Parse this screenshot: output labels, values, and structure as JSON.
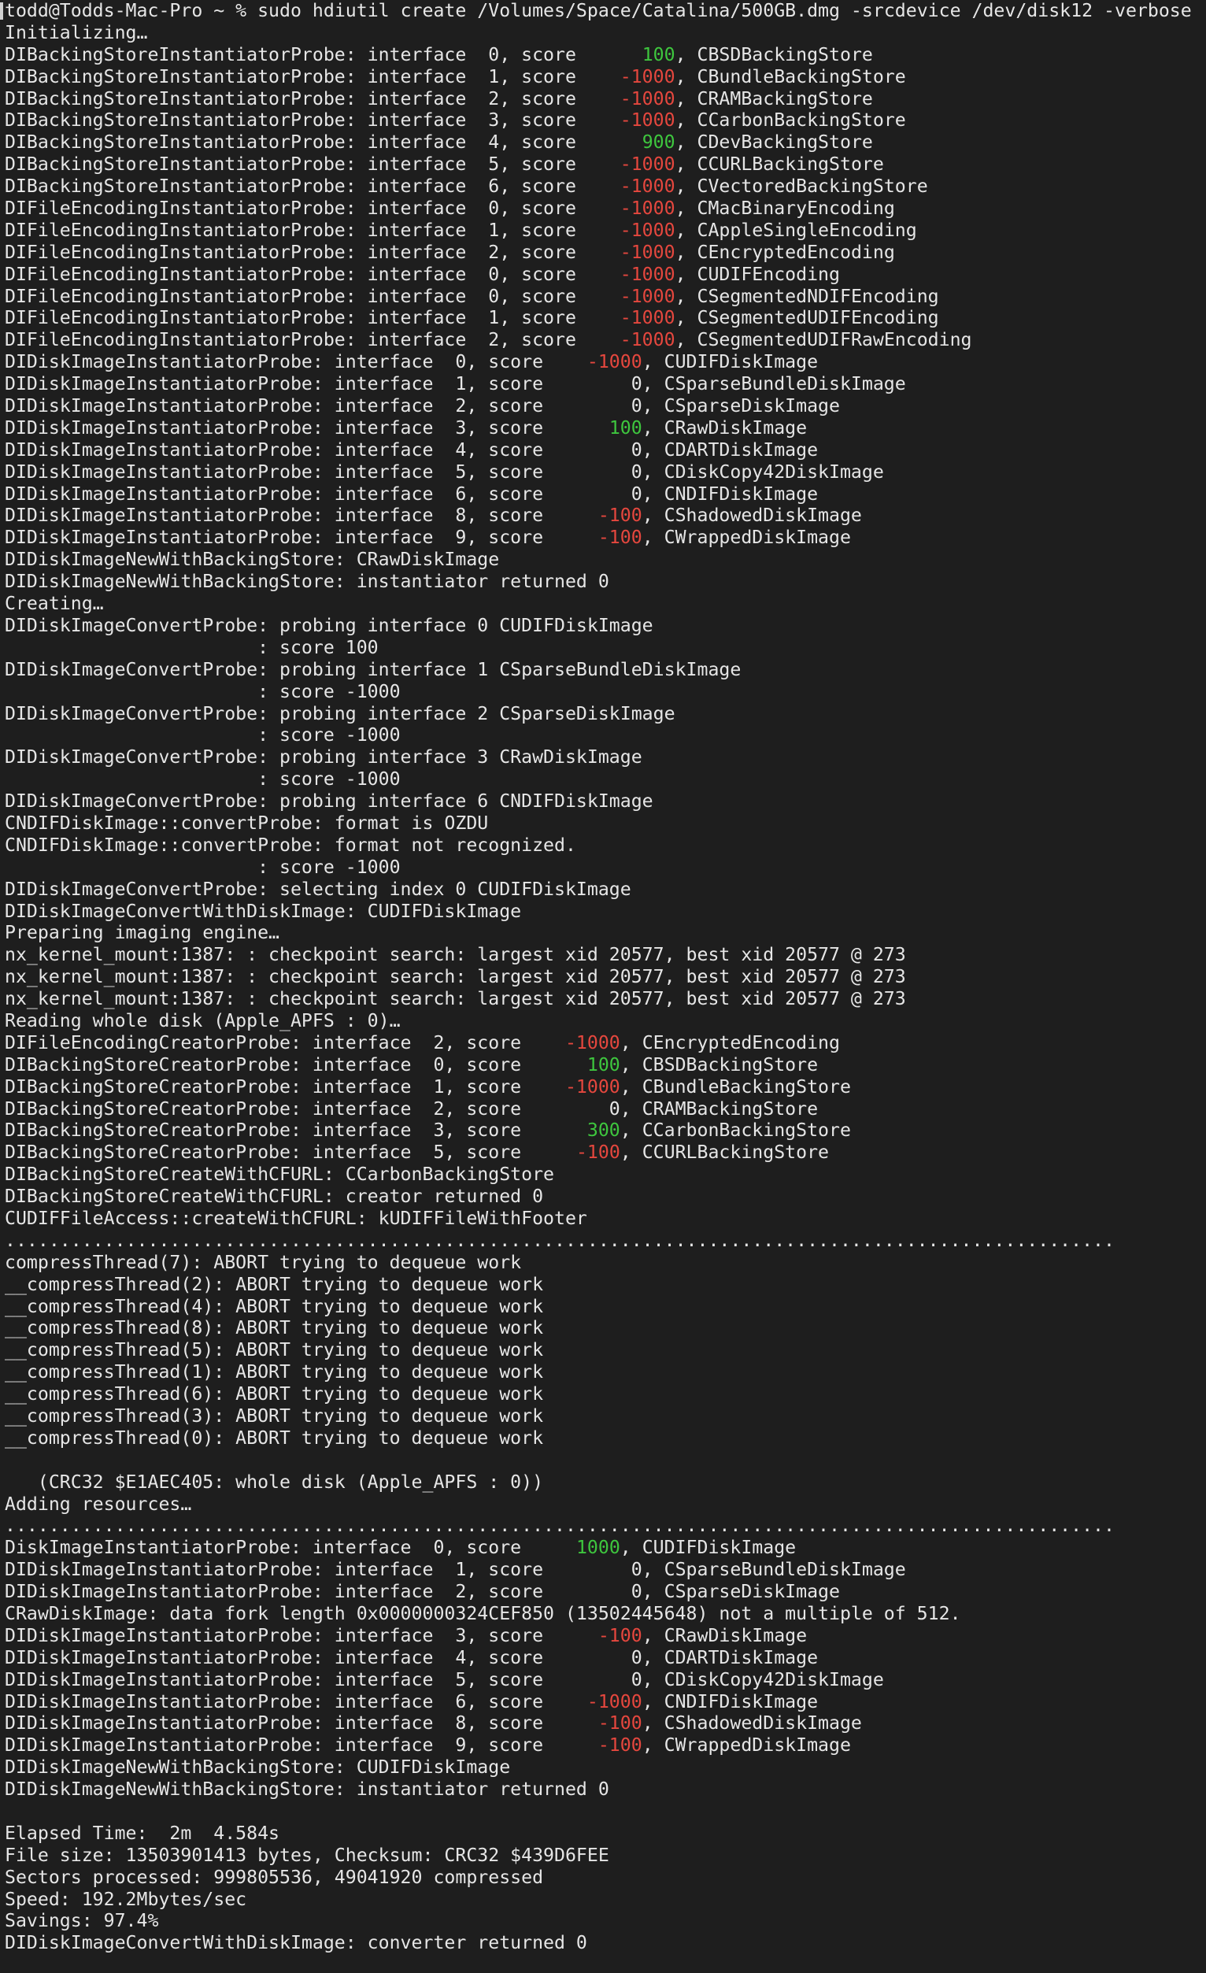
{
  "terminal": {
    "prompt": "todd@Todds-Mac-Pro ~ % ",
    "command": "sudo hdiutil create /Volumes/Space/Catalina/500GB.dmg -srcdevice /dev/disk12 -verbose",
    "colors": {
      "background": "#1e1e1e",
      "text": "#e6e6e6",
      "positive_score": "#3ec63e",
      "negative_score": "#e5473e"
    },
    "lines": [
      [
        {
          "t": "Initializing…"
        }
      ],
      [
        {
          "t": "DIBackingStoreInstantiatorProbe: interface  0, score      "
        },
        {
          "t": "100",
          "c": "green"
        },
        {
          "t": ", CBSDBackingStore"
        }
      ],
      [
        {
          "t": "DIBackingStoreInstantiatorProbe: interface  1, score    "
        },
        {
          "t": "-1000",
          "c": "red"
        },
        {
          "t": ", CBundleBackingStore"
        }
      ],
      [
        {
          "t": "DIBackingStoreInstantiatorProbe: interface  2, score    "
        },
        {
          "t": "-1000",
          "c": "red"
        },
        {
          "t": ", CRAMBackingStore"
        }
      ],
      [
        {
          "t": "DIBackingStoreInstantiatorProbe: interface  3, score    "
        },
        {
          "t": "-1000",
          "c": "red"
        },
        {
          "t": ", CCarbonBackingStore"
        }
      ],
      [
        {
          "t": "DIBackingStoreInstantiatorProbe: interface  4, score      "
        },
        {
          "t": "900",
          "c": "green"
        },
        {
          "t": ", CDevBackingStore"
        }
      ],
      [
        {
          "t": "DIBackingStoreInstantiatorProbe: interface  5, score    "
        },
        {
          "t": "-1000",
          "c": "red"
        },
        {
          "t": ", CCURLBackingStore"
        }
      ],
      [
        {
          "t": "DIBackingStoreInstantiatorProbe: interface  6, score    "
        },
        {
          "t": "-1000",
          "c": "red"
        },
        {
          "t": ", CVectoredBackingStore"
        }
      ],
      [
        {
          "t": "DIFileEncodingInstantiatorProbe: interface  0, score    "
        },
        {
          "t": "-1000",
          "c": "red"
        },
        {
          "t": ", CMacBinaryEncoding"
        }
      ],
      [
        {
          "t": "DIFileEncodingInstantiatorProbe: interface  1, score    "
        },
        {
          "t": "-1000",
          "c": "red"
        },
        {
          "t": ", CAppleSingleEncoding"
        }
      ],
      [
        {
          "t": "DIFileEncodingInstantiatorProbe: interface  2, score    "
        },
        {
          "t": "-1000",
          "c": "red"
        },
        {
          "t": ", CEncryptedEncoding"
        }
      ],
      [
        {
          "t": "DIFileEncodingInstantiatorProbe: interface  0, score    "
        },
        {
          "t": "-1000",
          "c": "red"
        },
        {
          "t": ", CUDIFEncoding"
        }
      ],
      [
        {
          "t": "DIFileEncodingInstantiatorProbe: interface  0, score    "
        },
        {
          "t": "-1000",
          "c": "red"
        },
        {
          "t": ", CSegmentedNDIFEncoding"
        }
      ],
      [
        {
          "t": "DIFileEncodingInstantiatorProbe: interface  1, score    "
        },
        {
          "t": "-1000",
          "c": "red"
        },
        {
          "t": ", CSegmentedUDIFEncoding"
        }
      ],
      [
        {
          "t": "DIFileEncodingInstantiatorProbe: interface  2, score    "
        },
        {
          "t": "-1000",
          "c": "red"
        },
        {
          "t": ", CSegmentedUDIFRawEncoding"
        }
      ],
      [
        {
          "t": "DIDiskImageInstantiatorProbe: interface  0, score    "
        },
        {
          "t": "-1000",
          "c": "red"
        },
        {
          "t": ", CUDIFDiskImage"
        }
      ],
      [
        {
          "t": "DIDiskImageInstantiatorProbe: interface  1, score        0, CSparseBundleDiskImage"
        }
      ],
      [
        {
          "t": "DIDiskImageInstantiatorProbe: interface  2, score        0, CSparseDiskImage"
        }
      ],
      [
        {
          "t": "DIDiskImageInstantiatorProbe: interface  3, score      "
        },
        {
          "t": "100",
          "c": "green"
        },
        {
          "t": ", CRawDiskImage"
        }
      ],
      [
        {
          "t": "DIDiskImageInstantiatorProbe: interface  4, score        0, CDARTDiskImage"
        }
      ],
      [
        {
          "t": "DIDiskImageInstantiatorProbe: interface  5, score        0, CDiskCopy42DiskImage"
        }
      ],
      [
        {
          "t": "DIDiskImageInstantiatorProbe: interface  6, score        0, CNDIFDiskImage"
        }
      ],
      [
        {
          "t": "DIDiskImageInstantiatorProbe: interface  8, score     "
        },
        {
          "t": "-100",
          "c": "red"
        },
        {
          "t": ", CShadowedDiskImage"
        }
      ],
      [
        {
          "t": "DIDiskImageInstantiatorProbe: interface  9, score     "
        },
        {
          "t": "-100",
          "c": "red"
        },
        {
          "t": ", CWrappedDiskImage"
        }
      ],
      [
        {
          "t": "DIDiskImageNewWithBackingStore: CRawDiskImage"
        }
      ],
      [
        {
          "t": "DIDiskImageNewWithBackingStore: instantiator returned 0"
        }
      ],
      [
        {
          "t": "Creating…"
        }
      ],
      [
        {
          "t": "DIDiskImageConvertProbe: probing interface 0 CUDIFDiskImage"
        }
      ],
      [
        {
          "t": "                       : score 100"
        }
      ],
      [
        {
          "t": "DIDiskImageConvertProbe: probing interface 1 CSparseBundleDiskImage"
        }
      ],
      [
        {
          "t": "                       : score -1000"
        }
      ],
      [
        {
          "t": "DIDiskImageConvertProbe: probing interface 2 CSparseDiskImage"
        }
      ],
      [
        {
          "t": "                       : score -1000"
        }
      ],
      [
        {
          "t": "DIDiskImageConvertProbe: probing interface 3 CRawDiskImage"
        }
      ],
      [
        {
          "t": "                       : score -1000"
        }
      ],
      [
        {
          "t": "DIDiskImageConvertProbe: probing interface 6 CNDIFDiskImage"
        }
      ],
      [
        {
          "t": "CNDIFDiskImage::convertProbe: format is OZDU"
        }
      ],
      [
        {
          "t": "CNDIFDiskImage::convertProbe: format not recognized."
        }
      ],
      [
        {
          "t": "                       : score -1000"
        }
      ],
      [
        {
          "t": "DIDiskImageConvertProbe: selecting index 0 CUDIFDiskImage"
        }
      ],
      [
        {
          "t": "DIDiskImageConvertWithDiskImage: CUDIFDiskImage"
        }
      ],
      [
        {
          "t": "Preparing imaging engine…"
        }
      ],
      [
        {
          "t": "nx_kernel_mount:1387: : checkpoint search: largest xid 20577, best xid 20577 @ 273"
        }
      ],
      [
        {
          "t": "nx_kernel_mount:1387: : checkpoint search: largest xid 20577, best xid 20577 @ 273"
        }
      ],
      [
        {
          "t": "nx_kernel_mount:1387: : checkpoint search: largest xid 20577, best xid 20577 @ 273"
        }
      ],
      [
        {
          "t": "Reading whole disk (Apple_APFS : 0)…"
        }
      ],
      [
        {
          "t": "DIFileEncodingCreatorProbe: interface  2, score    "
        },
        {
          "t": "-1000",
          "c": "red"
        },
        {
          "t": ", CEncryptedEncoding"
        }
      ],
      [
        {
          "t": "DIBackingStoreCreatorProbe: interface  0, score      "
        },
        {
          "t": "100",
          "c": "green"
        },
        {
          "t": ", CBSDBackingStore"
        }
      ],
      [
        {
          "t": "DIBackingStoreCreatorProbe: interface  1, score    "
        },
        {
          "t": "-1000",
          "c": "red"
        },
        {
          "t": ", CBundleBackingStore"
        }
      ],
      [
        {
          "t": "DIBackingStoreCreatorProbe: interface  2, score        0, CRAMBackingStore"
        }
      ],
      [
        {
          "t": "DIBackingStoreCreatorProbe: interface  3, score      "
        },
        {
          "t": "300",
          "c": "green"
        },
        {
          "t": ", CCarbonBackingStore"
        }
      ],
      [
        {
          "t": "DIBackingStoreCreatorProbe: interface  5, score     "
        },
        {
          "t": "-100",
          "c": "red"
        },
        {
          "t": ", CCURLBackingStore"
        }
      ],
      [
        {
          "t": "DIBackingStoreCreateWithCFURL: CCarbonBackingStore"
        }
      ],
      [
        {
          "t": "DIBackingStoreCreateWithCFURL: creator returned 0"
        }
      ],
      [
        {
          "t": "CUDIFFileAccess::createWithCFURL: kUDIFFileWithFooter"
        }
      ],
      [
        {
          "t": "....................................................................................................."
        }
      ],
      [
        {
          "t": "compressThread(7): ABORT trying to dequeue work"
        }
      ],
      [
        {
          "t": "__compressThread(2): ABORT trying to dequeue work"
        }
      ],
      [
        {
          "t": "__compressThread(4): ABORT trying to dequeue work"
        }
      ],
      [
        {
          "t": "__compressThread(8): ABORT trying to dequeue work"
        }
      ],
      [
        {
          "t": "__compressThread(5): ABORT trying to dequeue work"
        }
      ],
      [
        {
          "t": "__compressThread(1): ABORT trying to dequeue work"
        }
      ],
      [
        {
          "t": "__compressThread(6): ABORT trying to dequeue work"
        }
      ],
      [
        {
          "t": "__compressThread(3): ABORT trying to dequeue work"
        }
      ],
      [
        {
          "t": "__compressThread(0): ABORT trying to dequeue work"
        }
      ],
      [
        {
          "t": ""
        }
      ],
      [
        {
          "t": "   (CRC32 $E1AEC405: whole disk (Apple_APFS : 0))"
        }
      ],
      [
        {
          "t": "Adding resources…"
        }
      ],
      [
        {
          "t": "....................................................................................................."
        }
      ],
      [
        {
          "t": "DiskImageInstantiatorProbe: interface  0, score     "
        },
        {
          "t": "1000",
          "c": "green"
        },
        {
          "t": ", CUDIFDiskImage"
        }
      ],
      [
        {
          "t": "DIDiskImageInstantiatorProbe: interface  1, score        0, CSparseBundleDiskImage"
        }
      ],
      [
        {
          "t": "DIDiskImageInstantiatorProbe: interface  2, score        0, CSparseDiskImage"
        }
      ],
      [
        {
          "t": "CRawDiskImage: data fork length 0x0000000324CEF850 (13502445648) not a multiple of 512."
        }
      ],
      [
        {
          "t": "DIDiskImageInstantiatorProbe: interface  3, score     "
        },
        {
          "t": "-100",
          "c": "red"
        },
        {
          "t": ", CRawDiskImage"
        }
      ],
      [
        {
          "t": "DIDiskImageInstantiatorProbe: interface  4, score        0, CDARTDiskImage"
        }
      ],
      [
        {
          "t": "DIDiskImageInstantiatorProbe: interface  5, score        0, CDiskCopy42DiskImage"
        }
      ],
      [
        {
          "t": "DIDiskImageInstantiatorProbe: interface  6, score    "
        },
        {
          "t": "-1000",
          "c": "red"
        },
        {
          "t": ", CNDIFDiskImage"
        }
      ],
      [
        {
          "t": "DIDiskImageInstantiatorProbe: interface  8, score     "
        },
        {
          "t": "-100",
          "c": "red"
        },
        {
          "t": ", CShadowedDiskImage"
        }
      ],
      [
        {
          "t": "DIDiskImageInstantiatorProbe: interface  9, score     "
        },
        {
          "t": "-100",
          "c": "red"
        },
        {
          "t": ", CWrappedDiskImage"
        }
      ],
      [
        {
          "t": "DIDiskImageNewWithBackingStore: CUDIFDiskImage"
        }
      ],
      [
        {
          "t": "DIDiskImageNewWithBackingStore: instantiator returned 0"
        }
      ],
      [
        {
          "t": ""
        }
      ],
      [
        {
          "t": "Elapsed Time:  2m  4.584s"
        }
      ],
      [
        {
          "t": "File size: 13503901413 bytes, Checksum: CRC32 $439D6FEE"
        }
      ],
      [
        {
          "t": "Sectors processed: 999805536, 49041920 compressed"
        }
      ],
      [
        {
          "t": "Speed: 192.2Mbytes/sec"
        }
      ],
      [
        {
          "t": "Savings: 97.4%"
        }
      ],
      [
        {
          "t": "DIDiskImageConvertWithDiskImage: converter returned 0"
        }
      ]
    ]
  }
}
